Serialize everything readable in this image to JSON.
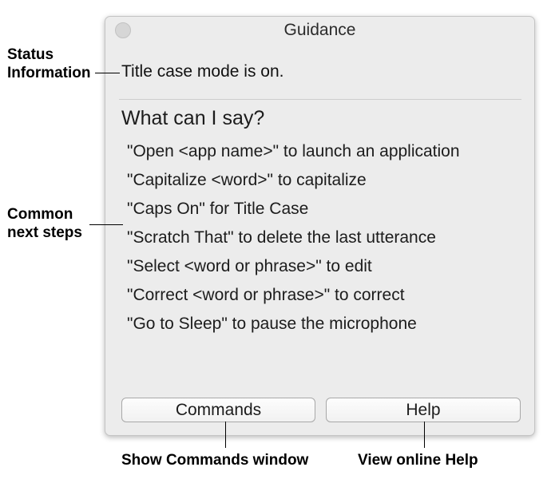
{
  "window": {
    "title": "Guidance",
    "status": "Title case mode is on.",
    "section_heading": "What can I say?",
    "steps": [
      "\"Open <app name>\" to launch an application",
      "\"Capitalize <word>\" to capitalize",
      "\"Caps On\" for Title Case",
      "\"Scratch That\" to delete the last utterance",
      "\"Select <word or phrase>\" to edit",
      "\"Correct <word or phrase>\" to correct",
      "\"Go to Sleep\" to pause the microphone"
    ],
    "buttons": {
      "commands": "Commands",
      "help": "Help"
    }
  },
  "annotations": {
    "status_line1": "Status",
    "status_line2": "Information",
    "steps_line1": "Common",
    "steps_line2": "next steps",
    "commands_caption": "Show Commands window",
    "help_caption": "View online Help"
  }
}
